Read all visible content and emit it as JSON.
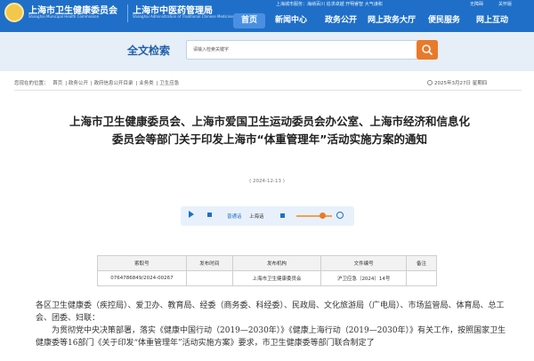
{
  "header": {
    "site1_title": "上海市卫生健康委员会",
    "site1_subtitle": "Shanghai Municipal Health Commission",
    "site2_title": "上海市中医药管理局",
    "site2_subtitle": "Shanghai Administration of Traditional Chinese Medicine",
    "ticker": "上海城市服务：海纳百川 追求卓越 开明睿智 大气谦和",
    "barrier_free": "无障碍",
    "care_mode": "关怀版",
    "mobile": "英文",
    "nav": [
      "首页",
      "新闻中心",
      "政务公开",
      "网上政务大厅",
      "便民服务",
      "网上互动"
    ]
  },
  "search": {
    "title": "全文检索",
    "placeholder": "请输入检索关键字"
  },
  "breadcrumb": {
    "prefix": "您现在的位置：",
    "items": [
      "首页",
      "政务公开",
      "政府信息公开目录",
      "业务类",
      "卫生应急"
    ]
  },
  "date_text": "2025年3月27日 星期四",
  "article": {
    "title": "上海市卫生健康委员会、上海市爱国卫生运动委员会办公室、上海市经济和信息化委员会等部门关于印发上海市“体重管理年”活动实施方案的通知",
    "publish_date": "( 2024-12-13 )",
    "audio": {
      "voice": "普通话",
      "dialect": "上海话"
    },
    "meta_headers": [
      "索取号",
      "发布时间",
      "发布机构",
      "文件编号",
      "备注"
    ],
    "meta_values": [
      "0764786849/2024-00267",
      "",
      "上海市卫生健康委员会",
      "沪卫应急〔2024〕14号",
      ""
    ],
    "body_line1": "各区卫生健康委（疾控局）、爱卫办、教育局、经委（商务委、科经委）、民政局、文化旅游局（广电局）、市场监管局、体育局、总工会、团委、妇联：",
    "body_line2": "为贯彻党中央决策部署，落实《健康中国行动（2019—2030年）》《健康上海行动（2019—2030年）》有关工作，按照国家卫生健康委等16部门《关于印发“体重管理年”活动实施方案》要求，市卫生健康委等部门联合制定了"
  }
}
